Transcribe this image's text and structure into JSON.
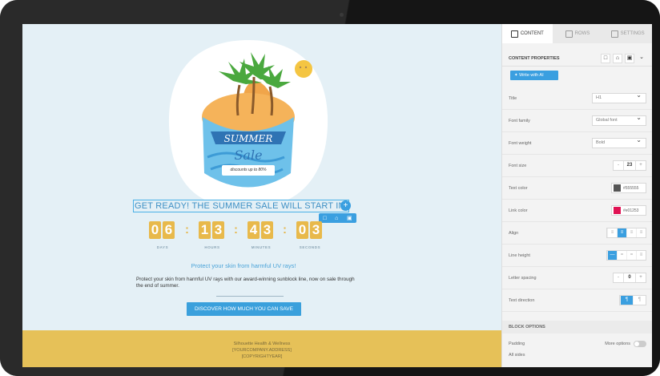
{
  "canvas": {
    "hero": {
      "title": "SUMMER",
      "sale": "Sale",
      "discount": "discounts up to 80%"
    },
    "headline": "GET READY! THE SUMMER SALE WILL START IN:",
    "timer": {
      "digits": [
        "0",
        "6",
        "1",
        "3",
        "4",
        "3",
        "0",
        "3"
      ],
      "units": [
        "DAYS",
        "HOURS",
        "MINUTES",
        "SECONDS"
      ]
    },
    "subheading": "Protect your skin from harmful UV rays!",
    "paragraph": "Protect your skin from harmful UV rays with our award-winning sunblock line, now on sale through the end of summer.",
    "cta_label": "DISCOVER HOW MUCH YOU CAN SAVE",
    "footer": [
      "Silhouette Health & Wellness",
      "[YOURCOMPANY.ADDRESS]",
      "[COPYRIGHTYEAR]"
    ]
  },
  "panel": {
    "tabs": [
      "CONTENT",
      "ROWS",
      "SETTINGS"
    ],
    "content_properties": "CONTENT PROPERTIES",
    "write_ai": "Write with AI",
    "rows": {
      "title": {
        "label": "Title",
        "value": "H1"
      },
      "font_family": {
        "label": "Font family",
        "value": "Global font"
      },
      "font_weight": {
        "label": "Font weight",
        "value": "Bold"
      },
      "font_size": {
        "label": "Font size",
        "value": "23"
      },
      "text_color": {
        "label": "Text color",
        "value": "#555555"
      },
      "link_color": {
        "label": "Link color",
        "value": "#e01253"
      },
      "align": {
        "label": "Align"
      },
      "line_height": {
        "label": "Line height"
      },
      "letter_spacing": {
        "label": "Letter spacing",
        "value": "0"
      },
      "text_direction": {
        "label": "Text direction"
      }
    },
    "block_options": "BLOCK OPTIONS",
    "padding": {
      "label": "Padding",
      "more": "More options",
      "all_sides": "All sides"
    }
  },
  "colors": {
    "accent": "#3a9fe0",
    "gold": "#e8b94b",
    "text_swatch": "#555555",
    "link_swatch": "#e01253"
  }
}
